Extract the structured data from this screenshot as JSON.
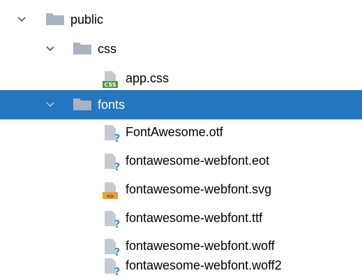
{
  "tree": {
    "items": [
      {
        "label": "public",
        "kind": "folder",
        "expanded": true,
        "selected": false,
        "icon": "folder-icon"
      },
      {
        "label": "css",
        "kind": "folder",
        "expanded": true,
        "selected": false,
        "icon": "folder-icon"
      },
      {
        "label": "app.css",
        "kind": "file",
        "selected": false,
        "icon": "css-file-icon",
        "badge": "CSS"
      },
      {
        "label": "fonts",
        "kind": "folder",
        "expanded": true,
        "selected": true,
        "icon": "folder-icon"
      },
      {
        "label": "FontAwesome.otf",
        "kind": "file",
        "selected": false,
        "icon": "unknown-file-icon",
        "badge": "?"
      },
      {
        "label": "fontawesome-webfont.eot",
        "kind": "file",
        "selected": false,
        "icon": "unknown-file-icon",
        "badge": "?"
      },
      {
        "label": "fontawesome-webfont.svg",
        "kind": "file",
        "selected": false,
        "icon": "svg-file-icon",
        "badge": "<>"
      },
      {
        "label": "fontawesome-webfont.ttf",
        "kind": "file",
        "selected": false,
        "icon": "unknown-file-icon",
        "badge": "?"
      },
      {
        "label": "fontawesome-webfont.woff",
        "kind": "file",
        "selected": false,
        "icon": "unknown-file-icon",
        "badge": "?"
      },
      {
        "label": "fontawesome-webfont.woff2",
        "kind": "file",
        "selected": false,
        "icon": "unknown-file-icon",
        "badge": "?"
      }
    ]
  },
  "colors": {
    "selection": "#2675bf",
    "folder": "#a9b3bf",
    "file": "#c5cbd1",
    "css_badge": "#4a9a3c",
    "svg_badge": "#e6a23c",
    "unknown_badge": "#3d8fd1"
  }
}
